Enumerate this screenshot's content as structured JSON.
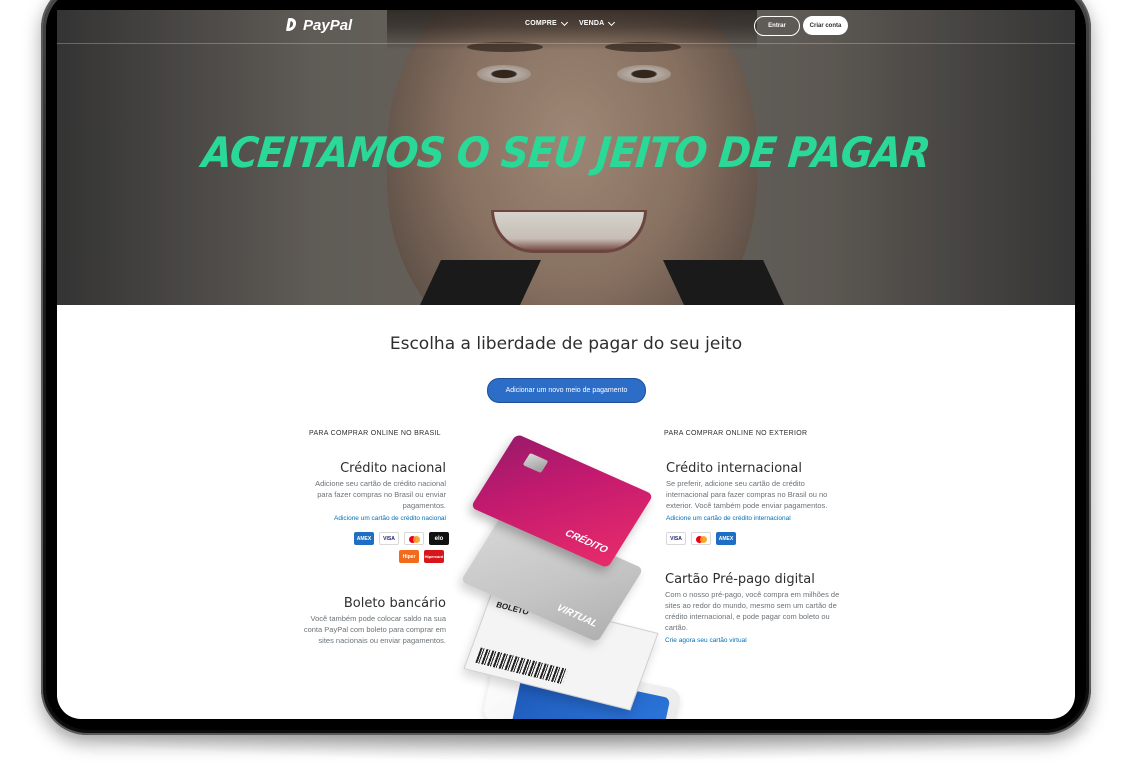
{
  "header": {
    "logo_text": "PayPal",
    "nav": [
      {
        "label": "COMPRE"
      },
      {
        "label": "VENDA"
      }
    ],
    "login_label": "Entrar",
    "signup_label": "Criar conta"
  },
  "hero": {
    "title": "ACEITAMOS O SEU JEITO DE PAGAR"
  },
  "main": {
    "subtitle": "Escolha a liberdade de pagar do seu jeito",
    "add_button_label": "Adicionar um novo meio de pagamento",
    "left_section_label": "PARA COMPRAR ONLINE NO BRASIL",
    "right_section_label": "PARA COMPRAR ONLINE NO EXTERIOR",
    "credito_nacional": {
      "title": "Crédito nacional",
      "text": "Adicione seu cartão de crédito nacional para fazer compras no Brasil ou enviar pagamentos.",
      "link": "Adicione um cartão de crédito nacional",
      "brands": [
        "AMEX",
        "VISA",
        "mastercard",
        "elo",
        "Hiper",
        "Hipercard"
      ]
    },
    "boleto": {
      "title": "Boleto bancário",
      "text": "Você também pode colocar saldo na sua conta PayPal com boleto para comprar em sites nacionais ou enviar pagamentos."
    },
    "credito_internacional": {
      "title": "Crédito internacional",
      "text": "Se preferir, adicione seu cartão de crédito internacional para fazer compras no Brasil ou no exterior. Você também pode enviar pagamentos.",
      "link": "Adicione um cartão de crédito internacional",
      "brands": [
        "VISA",
        "mastercard",
        "AMEX"
      ]
    },
    "prepago": {
      "title": "Cartão Pré-pago digital",
      "text": "Com o nosso pré-pago, você compra em milhões de sites ao redor do mundo, mesmo sem um cartão de crédito internacional, e pode pagar com boleto ou cartão.",
      "link": "Crie agora seu cartão virtual"
    },
    "illustration": {
      "credit_card_label": "CRÉDITO",
      "virtual_card_label": "VIRTUAL",
      "boleto_label": "BOLETO"
    }
  },
  "colors": {
    "hero_title": "#2ad898",
    "primary_button": "#2c6dc8",
    "link": "#0070ba"
  }
}
